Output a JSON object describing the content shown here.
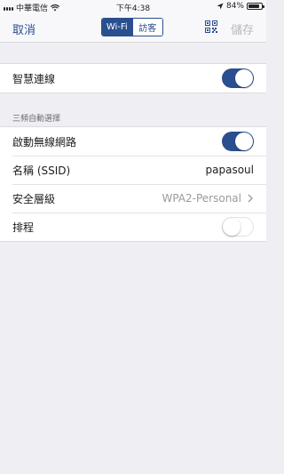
{
  "status_bar": {
    "carrier": "中華電信",
    "time": "下午4:38",
    "battery": "84%",
    "battery_level": 0.84,
    "icons": [
      "signal-icon",
      "wifi-icon",
      "location-arrow-icon",
      "battery-icon"
    ]
  },
  "nav": {
    "cancel_label": "取消",
    "tabs": [
      {
        "label": "Wi-Fi",
        "selected": true
      },
      {
        "label": "訪客",
        "selected": false
      }
    ],
    "qr_icon": "qr-code-icon",
    "save_label": "儲存"
  },
  "smart_connect": {
    "label": "智慧連線",
    "enabled": true
  },
  "tri_band": {
    "header": "三頻自動選擇",
    "enable_wireless": {
      "label": "啟動無線網路",
      "enabled": true
    },
    "ssid": {
      "label": "名稱 (SSID)",
      "value": "papasoul"
    },
    "security": {
      "label": "安全層級",
      "value": "WPA2-Personal"
    },
    "schedule": {
      "label": "排程",
      "enabled": false
    }
  },
  "colors": {
    "accent": "#2a4f8f",
    "background": "#eeeef3",
    "disabled_text": "#b8b8bd"
  }
}
